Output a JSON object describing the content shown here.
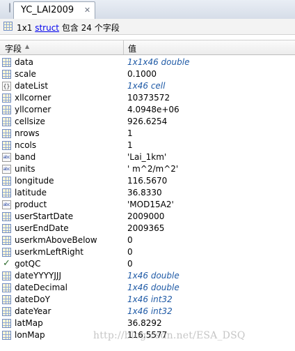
{
  "tab": {
    "title": "YC_LAI2009",
    "close_glyph": "✕"
  },
  "summary": {
    "prefix": "1x1",
    "link": "struct",
    "suffix": "包含 24 个字段"
  },
  "header": {
    "field_label": "字段",
    "value_label": "值"
  },
  "rows": [
    {
      "icon": "grid-icon",
      "name": "data",
      "value": "1x1x46 double",
      "italic": true
    },
    {
      "icon": "grid-icon",
      "name": "scale",
      "value": "0.1000",
      "italic": false
    },
    {
      "icon": "cell-icon",
      "name": "dateList",
      "value": "1x46 cell",
      "italic": true
    },
    {
      "icon": "grid-icon",
      "name": "xllcorner",
      "value": "10373572",
      "italic": false
    },
    {
      "icon": "grid-icon",
      "name": "yllcorner",
      "value": "4.0948e+06",
      "italic": false
    },
    {
      "icon": "grid-icon",
      "name": "cellsize",
      "value": "926.6254",
      "italic": false
    },
    {
      "icon": "grid-icon",
      "name": "nrows",
      "value": "1",
      "italic": false
    },
    {
      "icon": "grid-icon",
      "name": "ncols",
      "value": "1",
      "italic": false
    },
    {
      "icon": "char-icon",
      "name": "band",
      "value": "'Lai_1km'",
      "italic": false
    },
    {
      "icon": "char-icon",
      "name": "units",
      "value": "' m^2/m^2'",
      "italic": false
    },
    {
      "icon": "grid-icon",
      "name": "longitude",
      "value": "116.5670",
      "italic": false
    },
    {
      "icon": "grid-icon",
      "name": "latitude",
      "value": "36.8330",
      "italic": false
    },
    {
      "icon": "char-icon",
      "name": "product",
      "value": "'MOD15A2'",
      "italic": false
    },
    {
      "icon": "grid-icon",
      "name": "userStartDate",
      "value": "2009000",
      "italic": false
    },
    {
      "icon": "grid-icon",
      "name": "userEndDate",
      "value": "2009365",
      "italic": false
    },
    {
      "icon": "grid-icon",
      "name": "userkmAboveBelow",
      "value": "0",
      "italic": false
    },
    {
      "icon": "grid-icon",
      "name": "userkmLeftRight",
      "value": "0",
      "italic": false
    },
    {
      "icon": "check-icon",
      "name": "gotQC",
      "value": "0",
      "italic": false
    },
    {
      "icon": "grid-icon",
      "name": "dateYYYYJJJ",
      "value": "1x46 double",
      "italic": true
    },
    {
      "icon": "grid-icon",
      "name": "dateDecimal",
      "value": "1x46 double",
      "italic": true
    },
    {
      "icon": "grid-icon",
      "name": "dateDoY",
      "value": "1x46 int32",
      "italic": true
    },
    {
      "icon": "grid-icon",
      "name": "dateYear",
      "value": "1x46 int32",
      "italic": true
    },
    {
      "icon": "grid-icon",
      "name": "latMap",
      "value": "36.8292",
      "italic": false
    },
    {
      "icon": "grid-icon",
      "name": "lonMap",
      "value": "116.5577",
      "italic": false
    }
  ],
  "watermark": "http://blog.csdn.net/ESA_DSQ",
  "colors": {
    "italic_value": "#1f5aa6",
    "link": "#0000ee"
  }
}
